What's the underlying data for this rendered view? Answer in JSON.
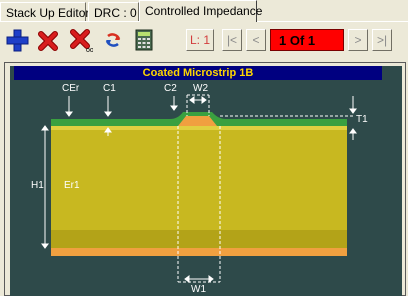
{
  "tabs": [
    {
      "label": "Stack Up Editor"
    },
    {
      "label": "DRC : 0"
    },
    {
      "label": "Controlled Impedance"
    }
  ],
  "toolbar": {
    "icons": [
      "add-icon",
      "delete-icon",
      "delete-all-icon",
      "refresh-icon",
      "calculator-icon"
    ],
    "layer_label": "L: 1",
    "first_label": "|<",
    "prev_label": "<",
    "page_value": "1 Of 1",
    "next_label": ">",
    "last_label": ">|"
  },
  "diagram": {
    "title": "Coated Microstrip 1B",
    "labels": {
      "cer": "CEr",
      "c1": "C1",
      "c2": "C2",
      "w2": "W2",
      "t1": "T1",
      "h1": "H1",
      "er1": "Er1",
      "w1": "W1"
    },
    "colors": {
      "background": "#2e4a4a",
      "title_bg": "#000080",
      "title_text": "#ffd700",
      "dielectric": "#c8b820",
      "coating": "#3aa040",
      "trace": "#f0a040",
      "ground": "#f0a040",
      "page_box": "#ff0000"
    }
  }
}
